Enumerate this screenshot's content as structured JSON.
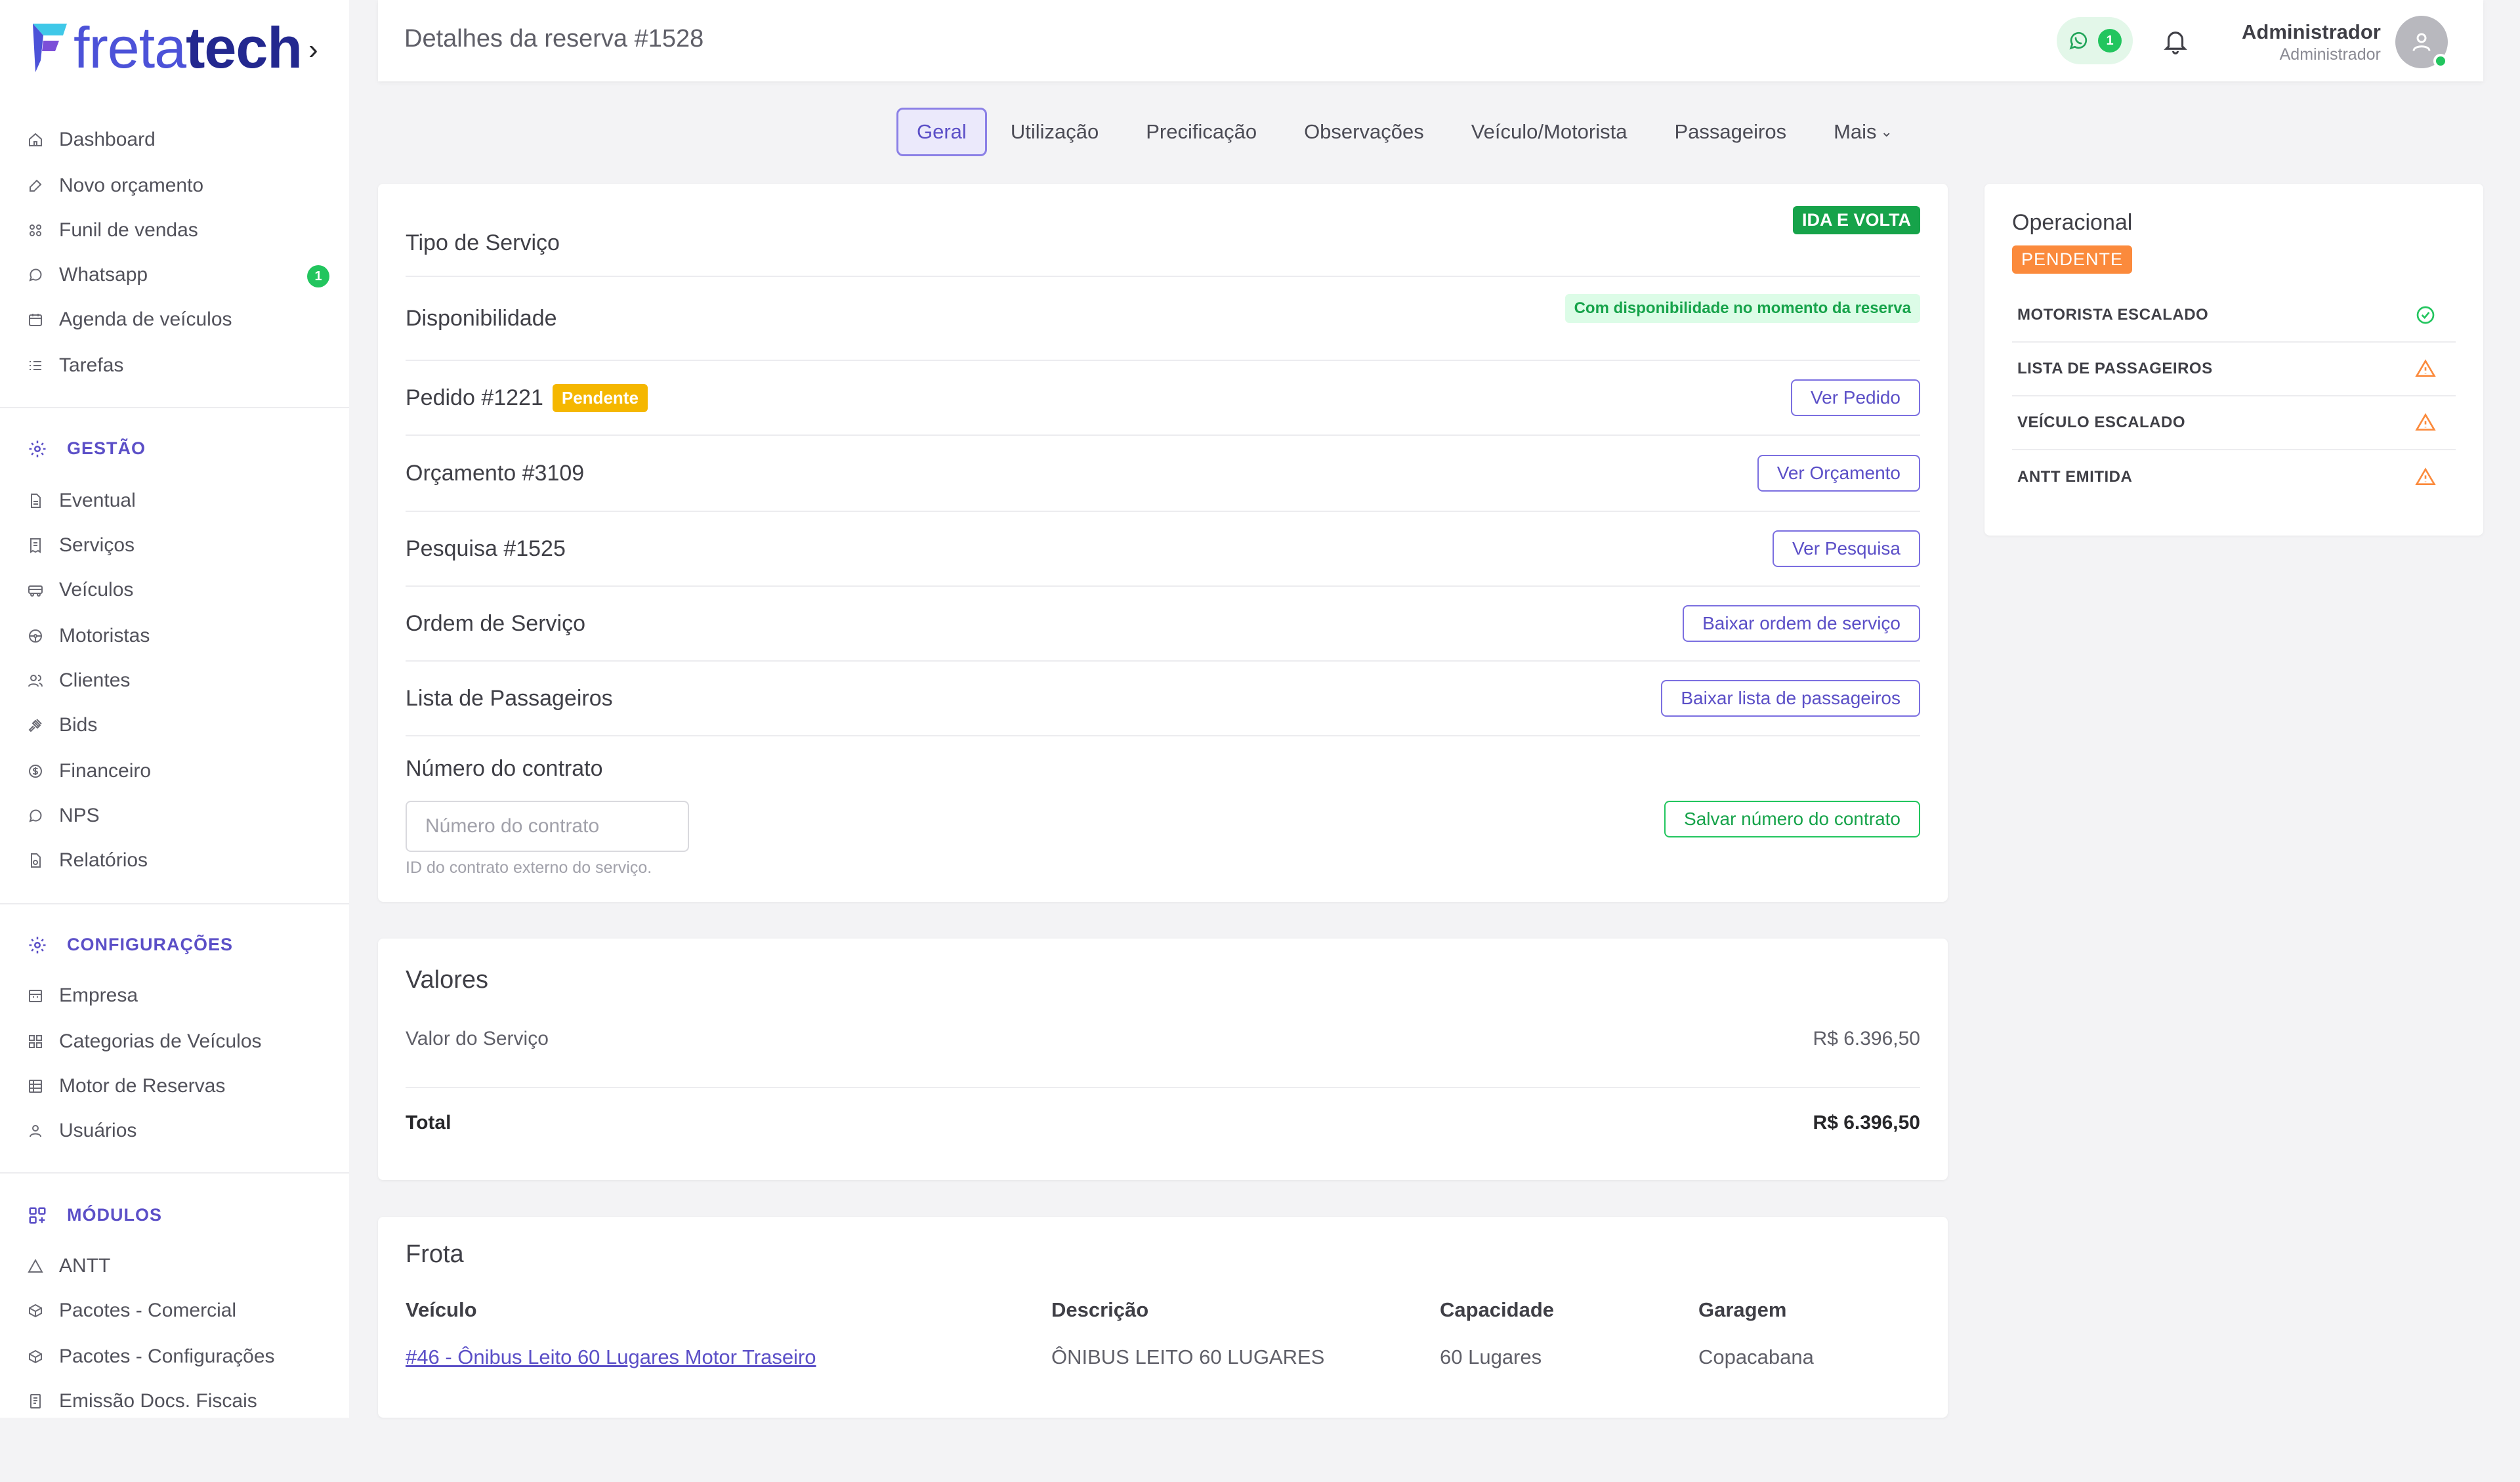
{
  "brand": {
    "part1": "freta",
    "part2": "tech",
    "primary": "#4c52d8",
    "dark": "#23288f"
  },
  "sidebar": {
    "main_items": [
      {
        "label": "Dashboard",
        "icon": "home-icon"
      },
      {
        "label": "Novo orçamento",
        "icon": "edit-icon"
      },
      {
        "label": "Funil de vendas",
        "icon": "funnel-icon"
      },
      {
        "label": "Whatsapp",
        "icon": "whatsapp-icon",
        "badge": "1"
      },
      {
        "label": "Agenda de veículos",
        "icon": "calendar-icon"
      },
      {
        "label": "Tarefas",
        "icon": "list-icon"
      }
    ],
    "gestao_title": "GESTÃO",
    "gestao_items": [
      {
        "label": "Eventual",
        "icon": "file-icon"
      },
      {
        "label": "Serviços",
        "icon": "receipt-icon"
      },
      {
        "label": "Veículos",
        "icon": "bus-icon"
      },
      {
        "label": "Motoristas",
        "icon": "steering-wheel-icon"
      },
      {
        "label": "Clientes",
        "icon": "users-icon"
      },
      {
        "label": "Bids",
        "icon": "gavel-icon"
      },
      {
        "label": "Financeiro",
        "icon": "dollar-icon"
      },
      {
        "label": "NPS",
        "icon": "chat-icon"
      },
      {
        "label": "Relatórios",
        "icon": "report-icon"
      }
    ],
    "config_title": "CONFIGURAÇÕES",
    "config_items": [
      {
        "label": "Empresa",
        "icon": "building-icon"
      },
      {
        "label": "Categorias de Veículos",
        "icon": "grid-icon"
      },
      {
        "label": "Motor de Reservas",
        "icon": "table-icon"
      },
      {
        "label": "Usuários",
        "icon": "user-icon"
      }
    ],
    "modulos_title": "MÓDULOS",
    "modulos_items": [
      {
        "label": "ANTT",
        "icon": "triangle-icon"
      },
      {
        "label": "Pacotes - Comercial",
        "icon": "package-icon"
      },
      {
        "label": "Pacotes - Configurações",
        "icon": "package-config-icon"
      },
      {
        "label": "Emissão Docs. Fiscais",
        "icon": "invoice-icon"
      }
    ]
  },
  "header": {
    "title": "Detalhes da reserva #1528",
    "whatsapp_count": "1",
    "user_name": "Administrador",
    "user_role": "Administrador"
  },
  "tabs": [
    {
      "label": "Geral",
      "active": true
    },
    {
      "label": "Utilização"
    },
    {
      "label": "Precificação"
    },
    {
      "label": "Observações"
    },
    {
      "label": "Veículo/Motorista"
    },
    {
      "label": "Passageiros"
    },
    {
      "label": "Mais"
    }
  ],
  "details": {
    "tipo_label": "Tipo de Serviço",
    "tipo_badge": "IDA E VOLTA",
    "disp_label": "Disponibilidade",
    "disp_badge": "Com disponibilidade no momento da reserva",
    "pedido_label": "Pedido #1221",
    "pedido_badge": "Pendente",
    "pedido_button": "Ver Pedido",
    "orcamento_label": "Orçamento #3109",
    "orcamento_button": "Ver Orçamento",
    "pesquisa_label": "Pesquisa #1525",
    "pesquisa_button": "Ver Pesquisa",
    "ordem_label": "Ordem de Serviço",
    "ordem_button": "Baixar ordem de serviço",
    "lista_label": "Lista de Passageiros",
    "lista_button": "Baixar lista de passageiros",
    "contrato_label": "Número do contrato",
    "contrato_placeholder": "Número do contrato",
    "contrato_value": "",
    "contrato_help": "ID do contrato externo do serviço.",
    "contrato_button": "Salvar número do contrato"
  },
  "values": {
    "title": "Valores",
    "service_label": "Valor do Serviço",
    "service_amount": "R$ 6.396,50",
    "total_label": "Total",
    "total_amount": "R$ 6.396,50"
  },
  "fleet": {
    "title": "Frota",
    "headers": [
      "Veículo",
      "Descrição",
      "Capacidade",
      "Garagem"
    ],
    "rows": [
      [
        "#46 - Ônibus Leito 60 Lugares Motor Traseiro",
        "ÔNIBUS LEITO 60 LUGARES",
        "60 Lugares",
        "Copacabana"
      ]
    ]
  },
  "operational": {
    "title": "Operacional",
    "status": "PENDENTE",
    "items": [
      {
        "label": "MOTORISTA ESCALADO",
        "status": "ok"
      },
      {
        "label": "LISTA DE PASSAGEIROS",
        "status": "warning"
      },
      {
        "label": "VEÍCULO ESCALADO",
        "status": "warning"
      },
      {
        "label": "ANTT EMITIDA",
        "status": "warning"
      }
    ]
  }
}
